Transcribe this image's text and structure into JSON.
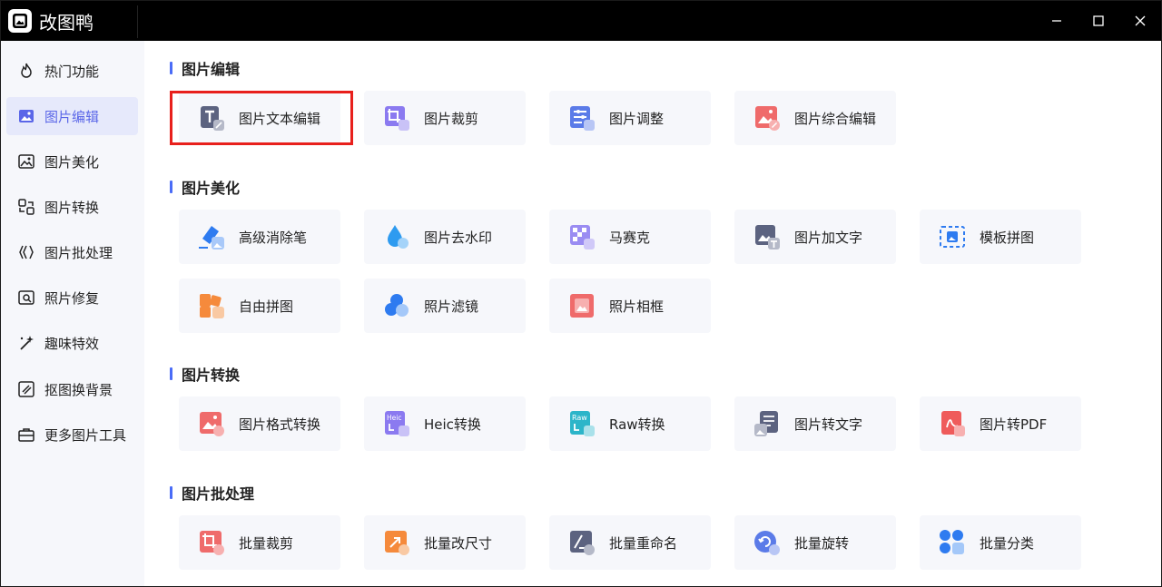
{
  "app": {
    "title": "改图鸭"
  },
  "window_controls": {
    "minimize": "—",
    "maximize": "☐",
    "close": "✕"
  },
  "sidebar": {
    "items": [
      {
        "label": "热门功能",
        "icon": "flame-icon"
      },
      {
        "label": "图片编辑",
        "icon": "image-edit-icon",
        "active": true
      },
      {
        "label": "图片美化",
        "icon": "image-beautify-icon"
      },
      {
        "label": "图片转换",
        "icon": "convert-icon"
      },
      {
        "label": "图片批处理",
        "icon": "batch-icon"
      },
      {
        "label": "照片修复",
        "icon": "repair-icon"
      },
      {
        "label": "趣味特效",
        "icon": "magic-wand-icon"
      },
      {
        "label": "抠图换背景",
        "icon": "cutout-icon"
      },
      {
        "label": "更多图片工具",
        "icon": "toolbox-icon"
      }
    ]
  },
  "sections": [
    {
      "title": "图片编辑",
      "tools": [
        {
          "label": "图片文本编辑",
          "icon": "text-edit-icon"
        },
        {
          "label": "图片裁剪",
          "icon": "crop-icon"
        },
        {
          "label": "图片调整",
          "icon": "adjust-icon"
        },
        {
          "label": "图片综合编辑",
          "icon": "comprehensive-edit-icon"
        }
      ]
    },
    {
      "title": "图片美化",
      "tools": [
        {
          "label": "高级消除笔",
          "icon": "eraser-icon"
        },
        {
          "label": "图片去水印",
          "icon": "watermark-remove-icon"
        },
        {
          "label": "马赛克",
          "icon": "mosaic-icon"
        },
        {
          "label": "图片加文字",
          "icon": "add-text-icon"
        },
        {
          "label": "模板拼图",
          "icon": "template-collage-icon"
        },
        {
          "label": "自由拼图",
          "icon": "free-collage-icon"
        },
        {
          "label": "照片滤镜",
          "icon": "filter-icon"
        },
        {
          "label": "照片相框",
          "icon": "frame-icon"
        }
      ]
    },
    {
      "title": "图片转换",
      "tools": [
        {
          "label": "图片格式转换",
          "icon": "format-convert-icon"
        },
        {
          "label": "Heic转换",
          "icon": "heic-icon",
          "badge": "Heic"
        },
        {
          "label": "Raw转换",
          "icon": "raw-icon",
          "badge": "Raw"
        },
        {
          "label": "图片转文字",
          "icon": "image-to-text-icon"
        },
        {
          "label": "图片转PDF",
          "icon": "pdf-icon"
        }
      ]
    },
    {
      "title": "图片批处理",
      "tools": [
        {
          "label": "批量裁剪",
          "icon": "batch-crop-icon"
        },
        {
          "label": "批量改尺寸",
          "icon": "batch-resize-icon"
        },
        {
          "label": "批量重命名",
          "icon": "batch-rename-icon"
        },
        {
          "label": "批量旋转",
          "icon": "batch-rotate-icon"
        },
        {
          "label": "批量分类",
          "icon": "batch-classify-icon"
        }
      ]
    }
  ],
  "colors": {
    "accent": "#5a66e8",
    "highlight": "#e8201c",
    "card_bg": "#f6f7fb"
  }
}
